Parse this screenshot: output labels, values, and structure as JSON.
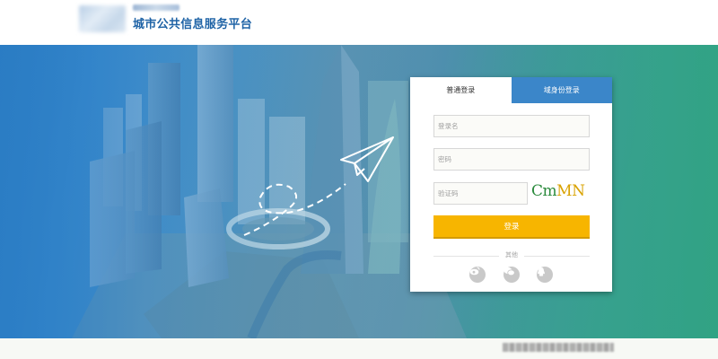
{
  "header": {
    "site_title": "城市公共信息服务平台"
  },
  "login": {
    "tabs": [
      {
        "label": "普通登录",
        "active": true
      },
      {
        "label": "域身份登录",
        "active": false
      }
    ],
    "username_placeholder": "登录名",
    "password_placeholder": "密码",
    "captcha_placeholder": "验证码",
    "captcha_chars": [
      "C",
      "m",
      "M",
      "N"
    ],
    "captcha_colors": [
      "#2a8a3c",
      "#2a8a3c",
      "#d9a200",
      "#d9a200"
    ],
    "login_button": "登录",
    "other_label": "其他",
    "social_icons": [
      "weibo-icon",
      "wechat-icon",
      "qq-icon"
    ]
  },
  "colors": {
    "accent_blue": "#3b86c9",
    "login_button": "#f7b500",
    "title_blue": "#1f63a6"
  }
}
